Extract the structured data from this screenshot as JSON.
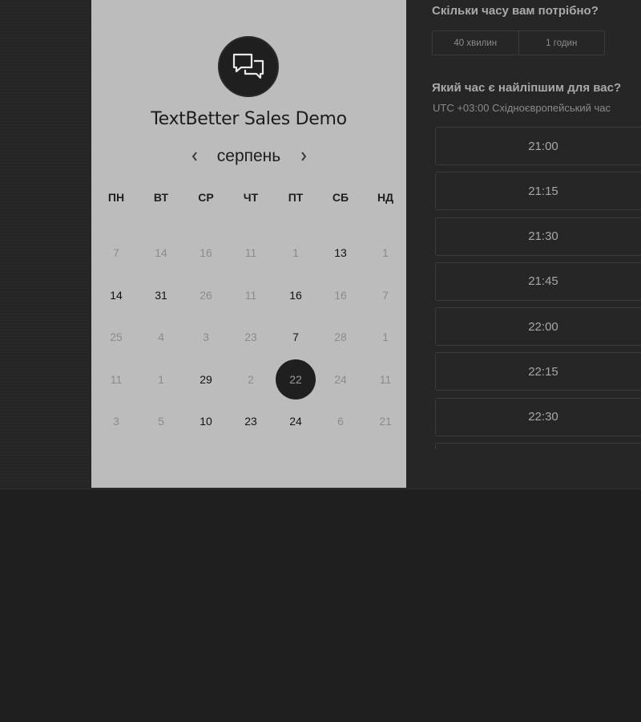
{
  "booking": {
    "title": "TextBetter Sales Demo",
    "month": "серпень",
    "weekdays": [
      "ПН",
      "ВТ",
      "СР",
      "ЧТ",
      "ПТ",
      "СБ",
      "НД"
    ],
    "days": [
      {
        "n": "7",
        "active": false
      },
      {
        "n": "14",
        "active": false
      },
      {
        "n": "16",
        "active": false
      },
      {
        "n": "11",
        "active": false
      },
      {
        "n": "1",
        "active": false
      },
      {
        "n": "13",
        "active": true
      },
      {
        "n": "1",
        "active": false
      },
      {
        "n": "14",
        "active": true
      },
      {
        "n": "31",
        "active": true
      },
      {
        "n": "26",
        "active": false
      },
      {
        "n": "11",
        "active": false
      },
      {
        "n": "16",
        "active": true
      },
      {
        "n": "16",
        "active": false
      },
      {
        "n": "7",
        "active": false
      },
      {
        "n": "25",
        "active": false
      },
      {
        "n": "4",
        "active": false
      },
      {
        "n": "3",
        "active": false
      },
      {
        "n": "23",
        "active": false
      },
      {
        "n": "7",
        "active": true
      },
      {
        "n": "28",
        "active": false
      },
      {
        "n": "1",
        "active": false
      },
      {
        "n": "11",
        "active": false
      },
      {
        "n": "1",
        "active": false
      },
      {
        "n": "29",
        "active": true
      },
      {
        "n": "2",
        "active": false
      },
      {
        "n": "22",
        "active": true,
        "selected": true
      },
      {
        "n": "24",
        "active": false
      },
      {
        "n": "11",
        "active": false
      },
      {
        "n": "3",
        "active": false
      },
      {
        "n": "5",
        "active": false
      },
      {
        "n": "10",
        "active": true
      },
      {
        "n": "23",
        "active": true
      },
      {
        "n": "24",
        "active": true
      },
      {
        "n": "6",
        "active": false
      },
      {
        "n": "21",
        "active": false
      }
    ]
  },
  "duration": {
    "question": "Скільки часу вам потрібно?",
    "options": [
      "40 хвилин",
      "1 годин"
    ]
  },
  "time": {
    "question": "Який час є найліпшим для вас?",
    "timezone": "UTC +03:00 Східноєвропейський час",
    "slots": [
      "21:00",
      "21:15",
      "21:30",
      "21:45",
      "22:00",
      "22:15",
      "22:30",
      ""
    ]
  },
  "colors": {
    "card_bg": "#bcbcbc",
    "page_bg": "#1f1f1f",
    "selected_day": "#1f1f1f"
  },
  "icons": {
    "logo": "chat-bubbles-icon",
    "prev": "chevron-left-icon",
    "next": "chevron-right-icon"
  }
}
